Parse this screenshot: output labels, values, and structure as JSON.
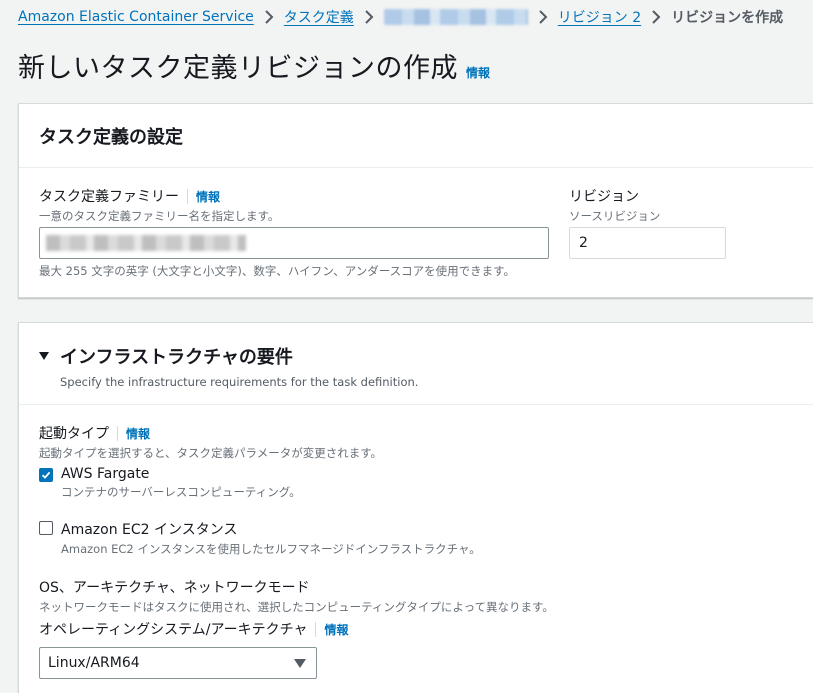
{
  "breadcrumb": {
    "service": "Amazon Elastic Container Service",
    "task_definitions": "タスク定義",
    "revision": "リビジョン 2",
    "current": "リビジョンを作成"
  },
  "page": {
    "title": "新しいタスク定義リビジョンの作成",
    "info": "情報"
  },
  "task_settings": {
    "title": "タスク定義の設定",
    "family_label": "タスク定義ファミリー",
    "family_info": "情報",
    "family_description": "一意のタスク定義ファミリー名を指定します。",
    "family_constraint": "最大 255 文字の英字 (大文字と小文字)、数字、ハイフン、アンダースコアを使用できます。",
    "revision_label": "リビジョン",
    "revision_description": "ソースリビジョン",
    "revision_value": "2"
  },
  "infra": {
    "title": "インフラストラクチャの要件",
    "description": "Specify the infrastructure requirements for the task definition.",
    "launch_type_label": "起動タイプ",
    "launch_type_info": "情報",
    "launch_type_description": "起動タイプを選択すると、タスク定義パラメータが変更されます。",
    "fargate_label": "AWS Fargate",
    "fargate_description": "コンテナのサーバーレスコンピューティング。",
    "fargate_checked": true,
    "ec2_label": "Amazon EC2 インスタンス",
    "ec2_description": "Amazon EC2 インスタンスを使用したセルフマネージドインフラストラクチャ。",
    "ec2_checked": false,
    "os_section_label": "OS、アーキテクチャ、ネットワークモード",
    "os_section_description": "ネットワークモードはタスクに使用され、選択したコンピューティングタイプによって異なります。",
    "os_arch_label": "オペレーティングシステム/アーキテクチャ",
    "os_arch_info": "情報",
    "os_arch_value": "Linux/ARM64"
  },
  "colors": {
    "link": "#0073bb",
    "checkbox_checked": "#0073bb",
    "background": "#f2f3f3"
  }
}
